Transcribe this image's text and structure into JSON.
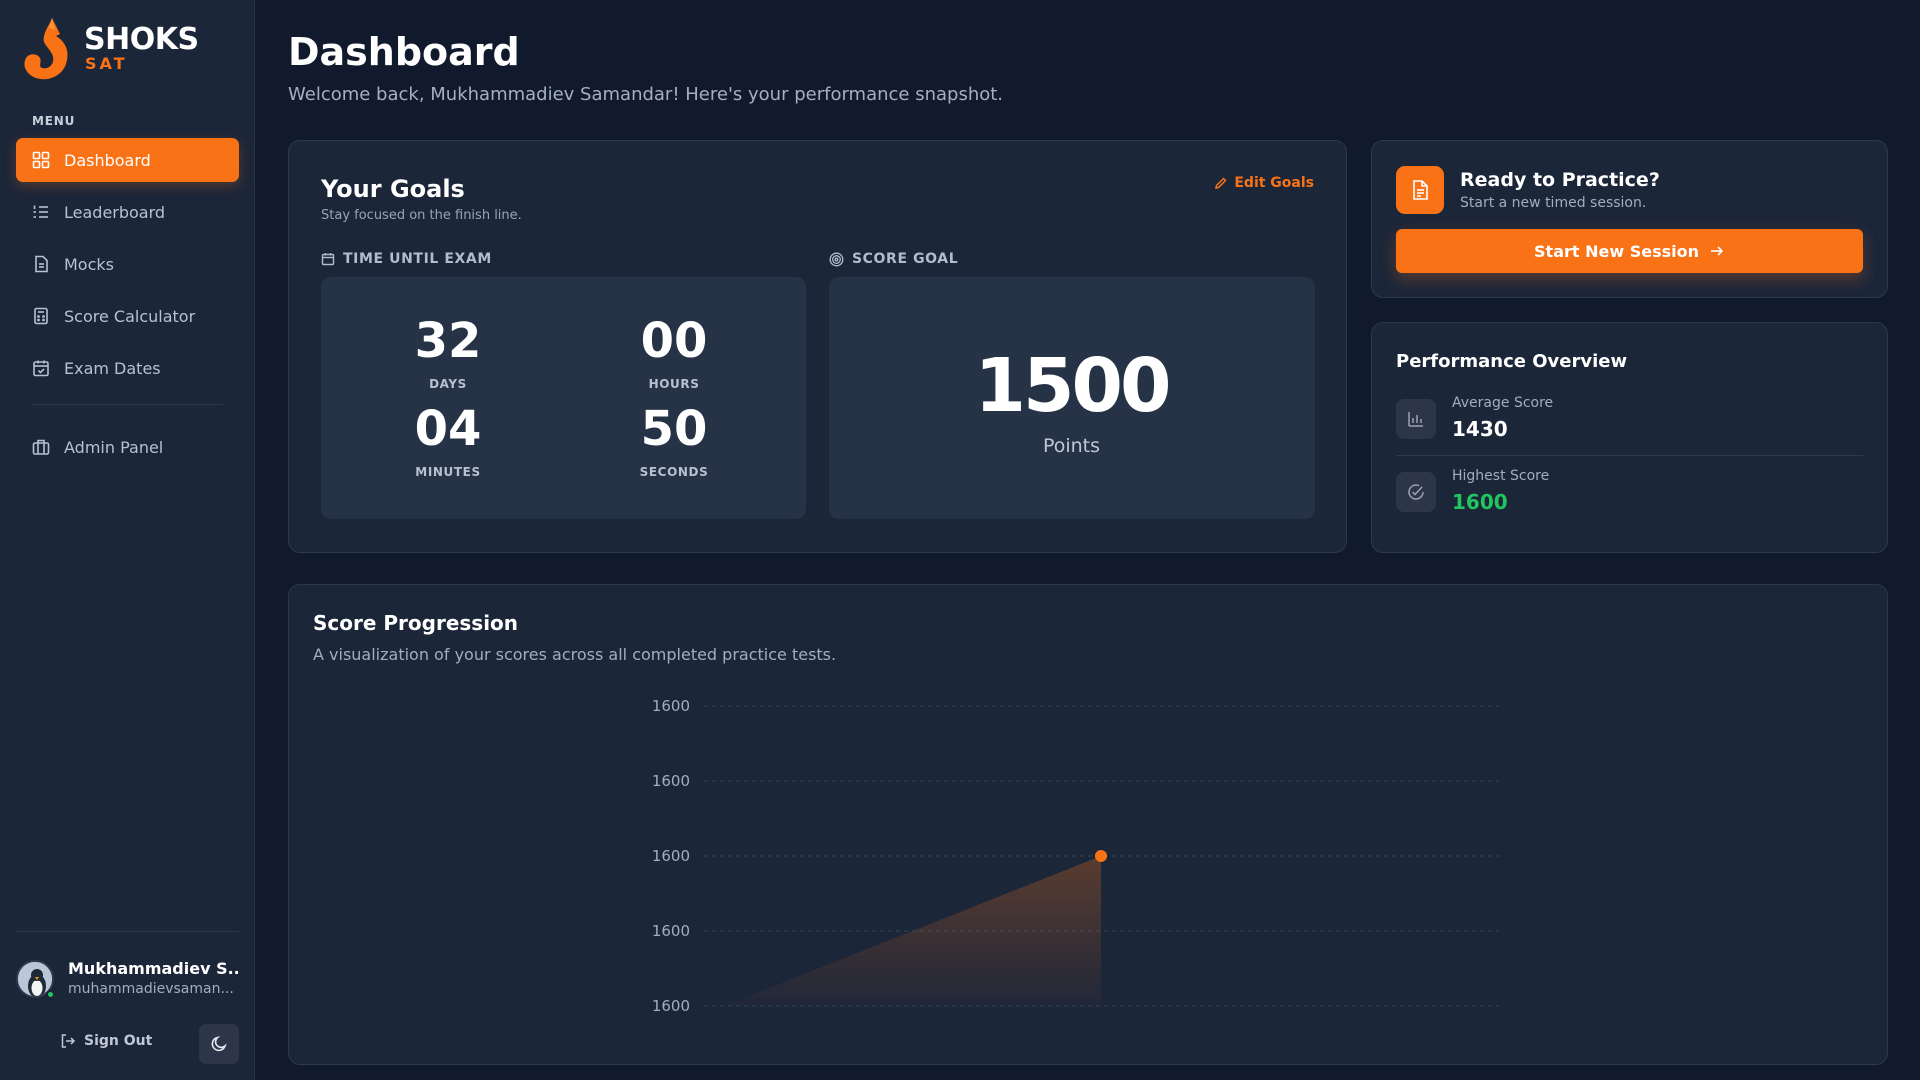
{
  "brand": {
    "name": "SHOKS",
    "sub": "SAT",
    "accent": "#f97316"
  },
  "sidebar": {
    "menu_title": "MENU",
    "items": [
      {
        "label": "Dashboard",
        "icon": "grid-icon",
        "active": true
      },
      {
        "label": "Leaderboard",
        "icon": "list-ordered-icon",
        "active": false
      },
      {
        "label": "Mocks",
        "icon": "document-icon",
        "active": false
      },
      {
        "label": "Score Calculator",
        "icon": "calculator-icon",
        "active": false
      },
      {
        "label": "Exam Dates",
        "icon": "calendar-check-icon",
        "active": false
      }
    ],
    "admin": {
      "label": "Admin Panel",
      "icon": "briefcase-icon"
    },
    "user": {
      "name": "Mukhammadiev S...",
      "email": "muhammadievsaman...",
      "status": "online"
    },
    "sign_out": "Sign Out",
    "theme_toggle_icon": "moon-icon"
  },
  "header": {
    "title": "Dashboard",
    "subtitle": "Welcome back, Mukhammadiev Samandar! Here's your performance snapshot."
  },
  "goals": {
    "title": "Your Goals",
    "subtitle": "Stay focused on the finish line.",
    "edit_label": "Edit Goals",
    "time_label": "TIME UNTIL EXAM",
    "countdown": {
      "days": "32",
      "days_label": "DAYS",
      "hours": "00",
      "hours_label": "HOURS",
      "minutes": "04",
      "minutes_label": "MINUTES",
      "seconds": "50",
      "seconds_label": "SECONDS"
    },
    "score_label": "SCORE GOAL",
    "score_value": "1500",
    "score_unit": "Points"
  },
  "practice": {
    "title": "Ready to Practice?",
    "subtitle": "Start a new timed session.",
    "button": "Start New Session"
  },
  "performance": {
    "title": "Performance Overview",
    "average_label": "Average Score",
    "average_value": "1430",
    "highest_label": "Highest Score",
    "highest_value": "1600",
    "highest_color": "#22c55e"
  },
  "progression": {
    "title": "Score Progression",
    "subtitle": "A visualization of your scores across all completed practice tests."
  },
  "chart_data": {
    "type": "area",
    "title": "Score Progression",
    "y_tick_labels": [
      "1600",
      "1600",
      "1600",
      "1600",
      "1600"
    ],
    "grid": true,
    "series": [
      {
        "values": [
          1600
        ],
        "color": "#f97316"
      }
    ]
  }
}
